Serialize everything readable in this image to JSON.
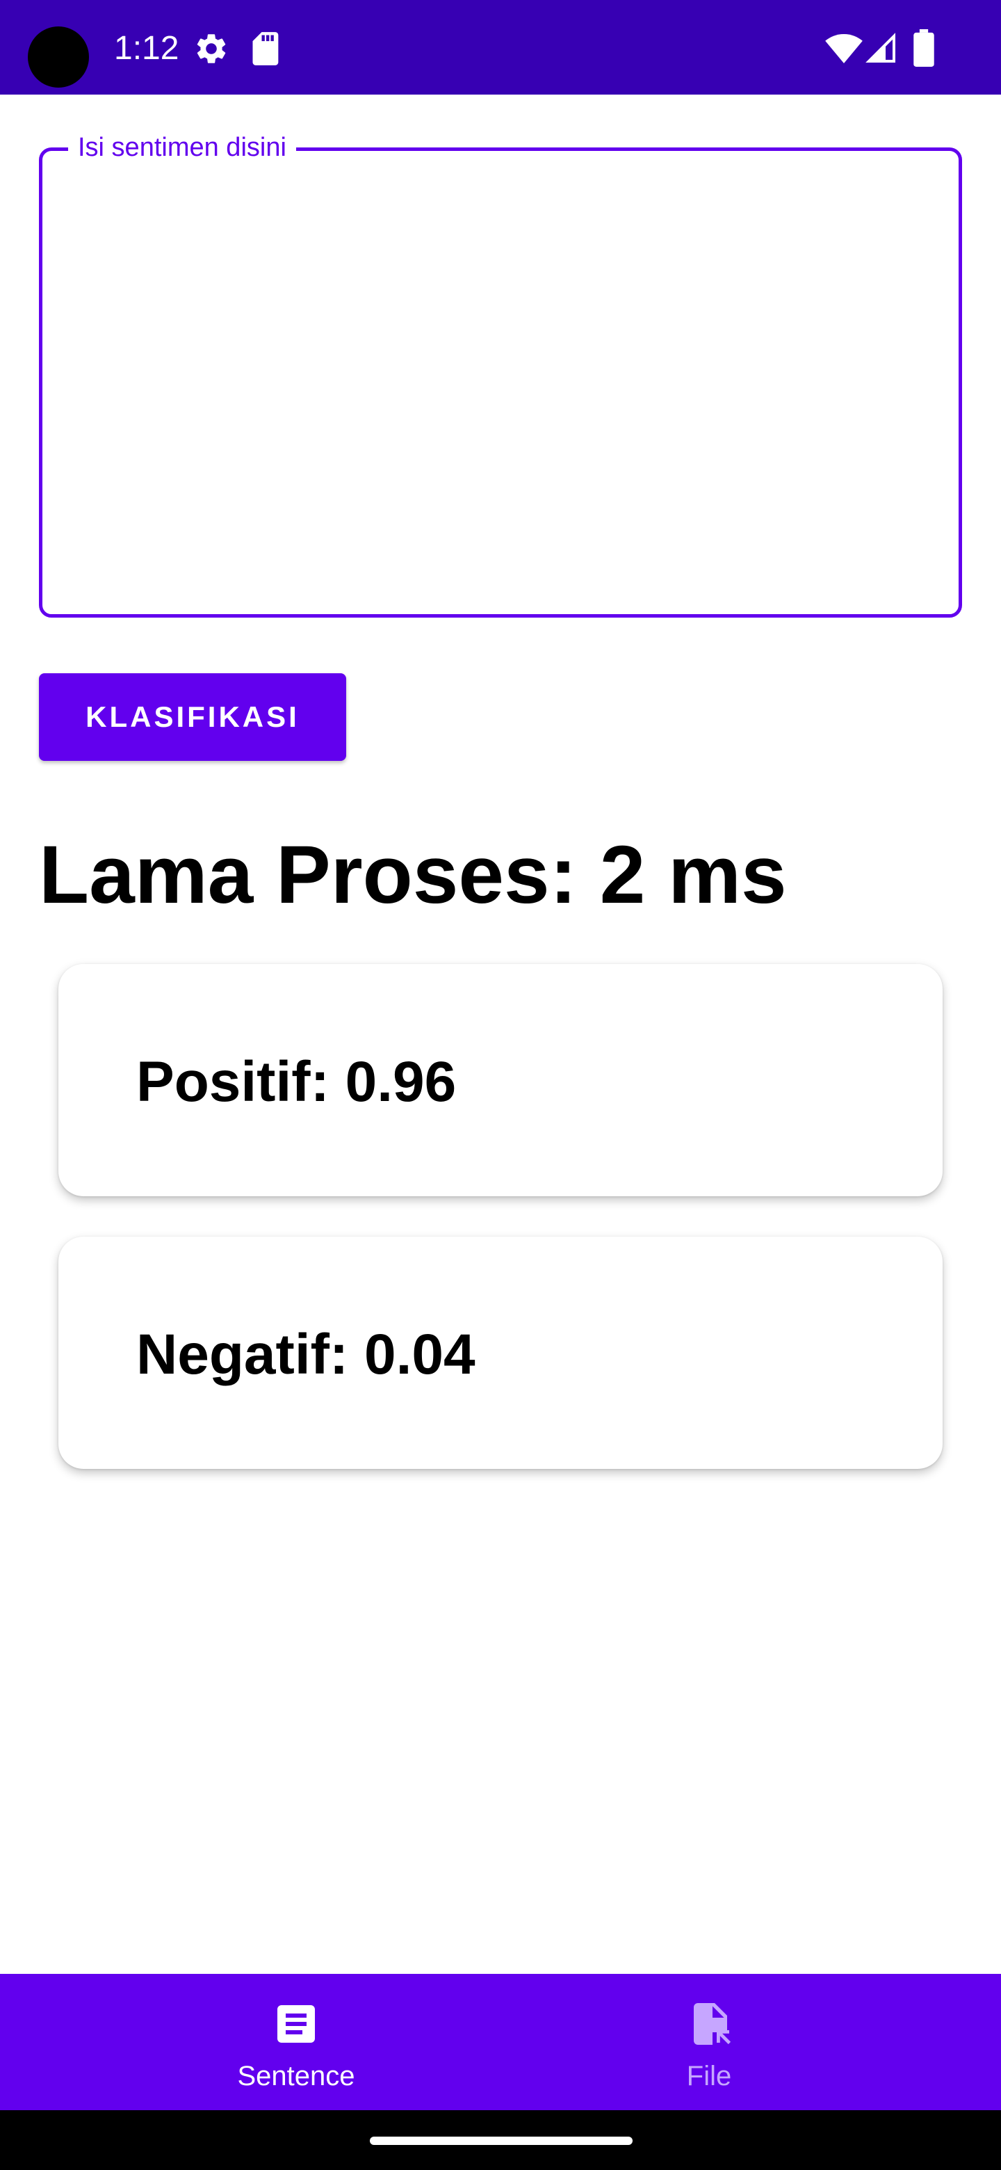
{
  "status_bar": {
    "time": "1:12",
    "icons": [
      "settings-icon",
      "sd-card-icon",
      "wifi-icon",
      "signal-icon",
      "battery-icon"
    ],
    "background_color": "#3700b3"
  },
  "input": {
    "label": "Isi sentimen disini",
    "value": ""
  },
  "classify_button": {
    "label": "KLASIFIKASI"
  },
  "process_time": {
    "text": "Lama Proses: 2 ms"
  },
  "results": [
    {
      "text": "Positif: 0.96"
    },
    {
      "text": "Negatif: 0.04"
    }
  ],
  "bottom_nav": {
    "items": [
      {
        "label": "Sentence",
        "icon": "document-text-icon",
        "selected": true
      },
      {
        "label": "File",
        "icon": "file-upload-icon",
        "selected": false
      }
    ]
  },
  "colors": {
    "accent": "#6200ee",
    "inactive_nav": "#c6a6ff"
  }
}
